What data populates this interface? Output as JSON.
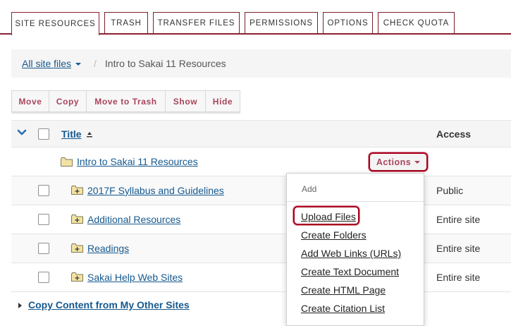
{
  "tabs": [
    "SITE RESOURCES",
    "TRASH",
    "TRANSFER FILES",
    "PERMISSIONS",
    "OPTIONS",
    "CHECK QUOTA"
  ],
  "active_tab": "SITE RESOURCES",
  "breadcrumb": {
    "root": "All site files",
    "separator": "/",
    "current": "Intro to Sakai 11 Resources"
  },
  "toolbar": [
    "Move",
    "Copy",
    "Move to Trash",
    "Show",
    "Hide"
  ],
  "table": {
    "col_title": "Title",
    "col_access": "Access",
    "parent_folder": "Intro to Sakai 11 Resources",
    "rows": [
      {
        "title": "2017F Syllabus and Guidelines",
        "access": "Public"
      },
      {
        "title": "Additional Resources",
        "access": "Entire site"
      },
      {
        "title": "Readings",
        "access": "Entire site"
      },
      {
        "title": "Sakai Help Web Sites",
        "access": "Entire site"
      }
    ]
  },
  "actions": {
    "button_label": "Actions",
    "menu_header": "Add",
    "menu_items": [
      "Upload Files",
      "Create Folders",
      "Add Web Links (URLs)",
      "Create Text Document",
      "Create HTML Page",
      "Create Citation List"
    ]
  },
  "copy_link": "Copy Content from My Other Sites",
  "colors": {
    "accent": "#8c2231",
    "link": "#15598f",
    "button_text": "#a8455b",
    "highlight": "#a8001e",
    "folder": "#f2e3a3"
  }
}
